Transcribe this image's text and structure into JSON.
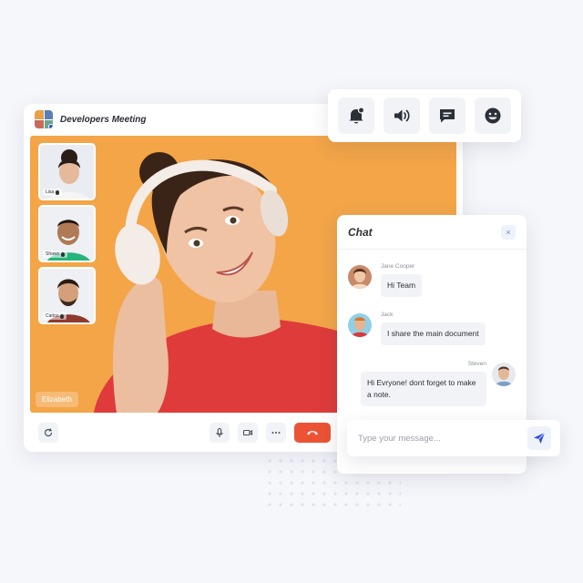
{
  "meeting": {
    "title": "Developers Meeting",
    "active_speaker": "Elizabeth",
    "participants": [
      {
        "name": "Lisa"
      },
      {
        "name": "Shawn"
      },
      {
        "name": "Carlos"
      }
    ]
  },
  "toolbar": {
    "icons": [
      "notification-bell-icon",
      "speaker-volume-icon",
      "message-icon",
      "emoji-icon"
    ]
  },
  "chat": {
    "title": "Chat",
    "close_icon": "×",
    "messages": [
      {
        "sender": "Jane Cooper",
        "text": "Hi Team",
        "side": "left"
      },
      {
        "sender": "Jack",
        "text": "I share the main document",
        "side": "left"
      },
      {
        "sender": "Steven",
        "text": "Hi Evryone! dont forget to make a note.",
        "side": "right"
      }
    ],
    "composer": {
      "placeholder": "Type your message..."
    }
  },
  "colors": {
    "stage_bg": "#f3a548",
    "hangup": "#ec5334",
    "accent": "#2c4be0"
  }
}
